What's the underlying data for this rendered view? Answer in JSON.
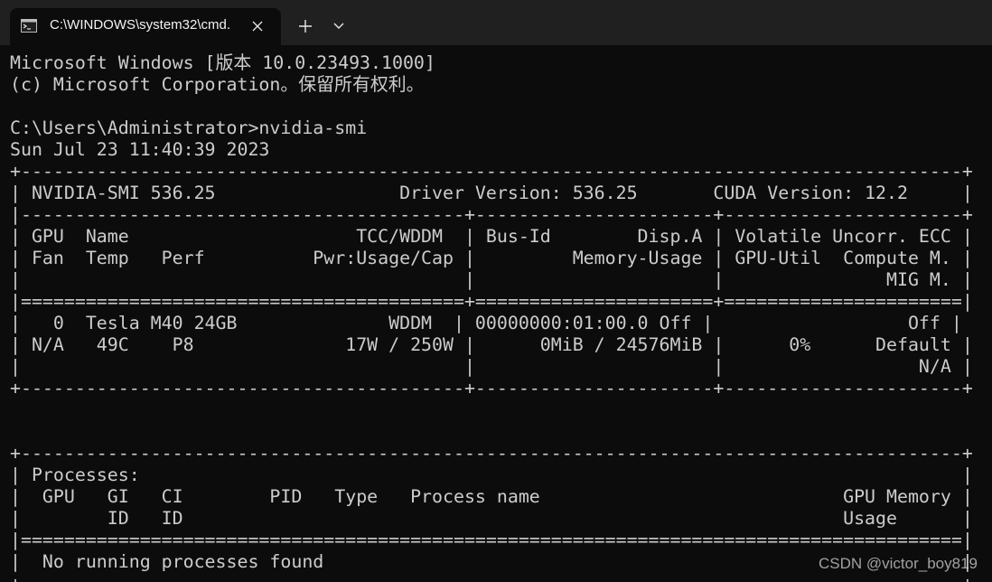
{
  "window": {
    "tab_title": "C:\\WINDOWS\\system32\\cmd.",
    "new_tab_label": "+",
    "close_tab_label": "×"
  },
  "terminal": {
    "lines": [
      "Microsoft Windows [版本 10.0.23493.1000]",
      "(c) Microsoft Corporation。保留所有权利。",
      "",
      "C:\\Users\\Administrator>nvidia-smi",
      "Sun Jul 23 11:40:39 2023",
      "+---------------------------------------------------------------------------------------+",
      "| NVIDIA-SMI 536.25                 Driver Version: 536.25       CUDA Version: 12.2     |",
      "|-----------------------------------------+----------------------+----------------------+",
      "| GPU  Name                     TCC/WDDM  | Bus-Id        Disp.A | Volatile Uncorr. ECC |",
      "| Fan  Temp   Perf          Pwr:Usage/Cap |         Memory-Usage | GPU-Util  Compute M. |",
      "|                                         |                      |               MIG M. |",
      "|=========================================+======================+======================|",
      "|   0  Tesla M40 24GB              WDDM  | 00000000:01:00.0 Off |                  Off |",
      "| N/A   49C    P8              17W / 250W |      0MiB / 24576MiB |      0%      Default |",
      "|                                         |                      |                  N/A |",
      "+-----------------------------------------+----------------------+----------------------+",
      "",
      "",
      "+---------------------------------------------------------------------------------------+",
      "| Processes:                                                                            |",
      "|  GPU   GI   CI        PID   Type   Process name                            GPU Memory |",
      "|        ID   ID                                                             Usage      |",
      "|=======================================================================================|",
      "|  No running processes found                                                           |",
      "+---------------------------------------------------------------------------------------+"
    ]
  },
  "watermark": "CSDN @victor_boy819",
  "colors": {
    "terminal_bg": "#0c0c0c",
    "terminal_fg": "#cccccc",
    "tabbar_bg": "#202020"
  }
}
